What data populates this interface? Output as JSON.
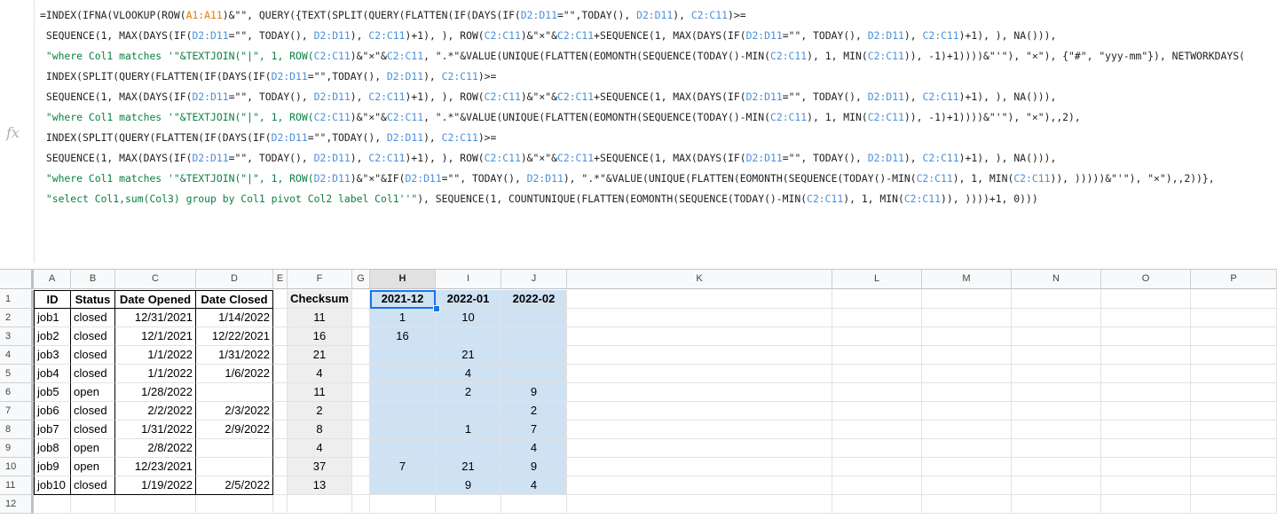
{
  "formula_bar": {
    "icon": "fx",
    "lines": [
      [
        [
          "=INDEX(IFNA(VLOOKUP(ROW(",
          ""
        ],
        [
          "A1:A11",
          "#e67c00"
        ],
        [
          ")&\"\", QUERY({TEXT(SPLIT(QUERY(FLATTEN(IF(DAYS(IF(",
          ""
        ],
        [
          "D2:D11",
          "#4a90d9"
        ],
        [
          "=\"\",TODAY(), ",
          ""
        ],
        [
          "D2:D11",
          "#4a90d9"
        ],
        [
          "), ",
          ""
        ],
        [
          "C2:C11",
          "#4a90d9"
        ],
        [
          ")>=",
          ""
        ]
      ],
      [
        [
          " SEQUENCE(1, MAX(DAYS(IF(",
          ""
        ],
        [
          "D2:D11",
          "#4a90d9"
        ],
        [
          "=\"\", TODAY(), ",
          ""
        ],
        [
          "D2:D11",
          "#4a90d9"
        ],
        [
          "), ",
          ""
        ],
        [
          "C2:C11",
          "#4a90d9"
        ],
        [
          ")+1), ), ROW(",
          ""
        ],
        [
          "C2:C11",
          "#4a90d9"
        ],
        [
          ")&\"×\"&",
          ""
        ],
        [
          "C2:C11",
          "#4a90d9"
        ],
        [
          "+SEQUENCE(1, MAX(DAYS(IF(",
          ""
        ],
        [
          "D2:D11",
          "#4a90d9"
        ],
        [
          "=\"\", TODAY(), ",
          ""
        ],
        [
          "D2:D11",
          "#4a90d9"
        ],
        [
          "), ",
          ""
        ],
        [
          "C2:C11",
          "#4a90d9"
        ],
        [
          ")+1), ), NA())),",
          ""
        ]
      ],
      [
        [
          " \"where Col1 matches '\"&TEXTJOIN(\"|\", 1, ROW(",
          "#0a8043"
        ],
        [
          "C2:C11",
          "#4a90d9"
        ],
        [
          ")&\"×\"&",
          ""
        ],
        [
          "C2:C11",
          "#4a90d9"
        ],
        [
          ", \".*\"&VALUE(UNIQUE(FLATTEN(EOMONTH(SEQUENCE(TODAY()-MIN(",
          ""
        ],
        [
          "C2:C11",
          "#4a90d9"
        ],
        [
          "), 1, MIN(",
          ""
        ],
        [
          "C2:C11",
          "#4a90d9"
        ],
        [
          ")), -1)+1))))&\"'\"), \"×\"), {\"#\", \"yyy-mm\"}), NETWORKDAYS(",
          ""
        ]
      ],
      [
        [
          " INDEX(SPLIT(QUERY(FLATTEN(IF(DAYS(IF(",
          ""
        ],
        [
          "D2:D11",
          "#4a90d9"
        ],
        [
          "=\"\",TODAY(), ",
          ""
        ],
        [
          "D2:D11",
          "#4a90d9"
        ],
        [
          "), ",
          ""
        ],
        [
          "C2:C11",
          "#4a90d9"
        ],
        [
          ")>=",
          ""
        ]
      ],
      [
        [
          " SEQUENCE(1, MAX(DAYS(IF(",
          ""
        ],
        [
          "D2:D11",
          "#4a90d9"
        ],
        [
          "=\"\", TODAY(), ",
          ""
        ],
        [
          "D2:D11",
          "#4a90d9"
        ],
        [
          "), ",
          ""
        ],
        [
          "C2:C11",
          "#4a90d9"
        ],
        [
          ")+1), ), ROW(",
          ""
        ],
        [
          "C2:C11",
          "#4a90d9"
        ],
        [
          ")&\"×\"&",
          ""
        ],
        [
          "C2:C11",
          "#4a90d9"
        ],
        [
          "+SEQUENCE(1, MAX(DAYS(IF(",
          ""
        ],
        [
          "D2:D11",
          "#4a90d9"
        ],
        [
          "=\"\", TODAY(), ",
          ""
        ],
        [
          "D2:D11",
          "#4a90d9"
        ],
        [
          "), ",
          ""
        ],
        [
          "C2:C11",
          "#4a90d9"
        ],
        [
          ")+1), ), NA())),",
          ""
        ]
      ],
      [
        [
          " \"where Col1 matches '\"&TEXTJOIN(\"|\", 1, ROW(",
          "#0a8043"
        ],
        [
          "C2:C11",
          "#4a90d9"
        ],
        [
          ")&\"×\"&",
          ""
        ],
        [
          "C2:C11",
          "#4a90d9"
        ],
        [
          ", \".*\"&VALUE(UNIQUE(FLATTEN(EOMONTH(SEQUENCE(TODAY()-MIN(",
          ""
        ],
        [
          "C2:C11",
          "#4a90d9"
        ],
        [
          "), 1, MIN(",
          ""
        ],
        [
          "C2:C11",
          "#4a90d9"
        ],
        [
          ")), -1)+1))))&\"'\"), \"×\"),,2),",
          ""
        ]
      ],
      [
        [
          " INDEX(SPLIT(QUERY(FLATTEN(IF(DAYS(IF(",
          ""
        ],
        [
          "D2:D11",
          "#4a90d9"
        ],
        [
          "=\"\",TODAY(), ",
          ""
        ],
        [
          "D2:D11",
          "#4a90d9"
        ],
        [
          "), ",
          ""
        ],
        [
          "C2:C11",
          "#4a90d9"
        ],
        [
          ")>=",
          ""
        ]
      ],
      [
        [
          " SEQUENCE(1, MAX(DAYS(IF(",
          ""
        ],
        [
          "D2:D11",
          "#4a90d9"
        ],
        [
          "=\"\", TODAY(), ",
          ""
        ],
        [
          "D2:D11",
          "#4a90d9"
        ],
        [
          "), ",
          ""
        ],
        [
          "C2:C11",
          "#4a90d9"
        ],
        [
          ")+1), ), ROW(",
          ""
        ],
        [
          "C2:C11",
          "#4a90d9"
        ],
        [
          ")&\"×\"&",
          ""
        ],
        [
          "C2:C11",
          "#4a90d9"
        ],
        [
          "+SEQUENCE(1, MAX(DAYS(IF(",
          ""
        ],
        [
          "D2:D11",
          "#4a90d9"
        ],
        [
          "=\"\", TODAY(), ",
          ""
        ],
        [
          "D2:D11",
          "#4a90d9"
        ],
        [
          "), ",
          ""
        ],
        [
          "C2:C11",
          "#4a90d9"
        ],
        [
          ")+1), ), NA())),",
          ""
        ]
      ],
      [
        [
          " \"where Col1 matches '\"&TEXTJOIN(\"|\", 1, ROW(",
          "#0a8043"
        ],
        [
          "D2:D11",
          "#4a90d9"
        ],
        [
          ")&\"×\"&IF(",
          ""
        ],
        [
          "D2:D11",
          "#4a90d9"
        ],
        [
          "=\"\", TODAY(), ",
          ""
        ],
        [
          "D2:D11",
          "#4a90d9"
        ],
        [
          "), \".*\"&VALUE(UNIQUE(FLATTEN(EOMONTH(SEQUENCE(TODAY()-MIN(",
          ""
        ],
        [
          "C2:C11",
          "#4a90d9"
        ],
        [
          "), 1, MIN(",
          ""
        ],
        [
          "C2:C11",
          "#4a90d9"
        ],
        [
          ")), )))))&\"'\"), \"×\"),,2))},",
          ""
        ]
      ],
      [
        [
          " \"select Col1,sum(Col3) group by Col1 pivot Col2 label Col1''\"",
          "#0a8043"
        ],
        [
          "), SEQUENCE(1, COUNTUNIQUE(FLATTEN(EOMONTH(SEQUENCE(TODAY()-MIN(",
          ""
        ],
        [
          "C2:C11",
          "#4a90d9"
        ],
        [
          "), 1, MIN(",
          ""
        ],
        [
          "C2:C11",
          "#4a90d9"
        ],
        [
          ")), ))))+1, 0)))",
          ""
        ]
      ]
    ]
  },
  "columns": [
    "A",
    "B",
    "C",
    "D",
    "E",
    "F",
    "G",
    "H",
    "I",
    "J",
    "K",
    "L",
    "M",
    "N",
    "O",
    "P"
  ],
  "selected_column": "H",
  "row_numbers": [
    "1",
    "2",
    "3",
    "4",
    "5",
    "6",
    "7",
    "8",
    "9",
    "10",
    "11",
    "12"
  ],
  "headers": {
    "A": "ID",
    "B": "Status",
    "C": "Date Opened",
    "D": "Date Closed",
    "F": "Checksum",
    "H": "2021-12",
    "I": "2022-01",
    "J": "2022-02"
  },
  "rows": [
    {
      "A": "job1",
      "B": "closed",
      "C": "12/31/2021",
      "D": "1/14/2022",
      "F": "11",
      "H": "1",
      "I": "10",
      "J": ""
    },
    {
      "A": "job2",
      "B": "closed",
      "C": "12/1/2021",
      "D": "12/22/2021",
      "F": "16",
      "H": "16",
      "I": "",
      "J": ""
    },
    {
      "A": "job3",
      "B": "closed",
      "C": "1/1/2022",
      "D": "1/31/2022",
      "F": "21",
      "H": "",
      "I": "21",
      "J": ""
    },
    {
      "A": "job4",
      "B": "closed",
      "C": "1/1/2022",
      "D": "1/6/2022",
      "F": "4",
      "H": "",
      "I": "4",
      "J": ""
    },
    {
      "A": "job5",
      "B": "open",
      "C": "1/28/2022",
      "D": "",
      "F": "11",
      "H": "",
      "I": "2",
      "J": "9"
    },
    {
      "A": "job6",
      "B": "closed",
      "C": "2/2/2022",
      "D": "2/3/2022",
      "F": "2",
      "H": "",
      "I": "",
      "J": "2"
    },
    {
      "A": "job7",
      "B": "closed",
      "C": "1/31/2022",
      "D": "2/9/2022",
      "F": "8",
      "H": "",
      "I": "1",
      "J": "7"
    },
    {
      "A": "job8",
      "B": "open",
      "C": "2/8/2022",
      "D": "",
      "F": "4",
      "H": "",
      "I": "",
      "J": "4"
    },
    {
      "A": "job9",
      "B": "open",
      "C": "12/23/2021",
      "D": "",
      "F": "37",
      "H": "7",
      "I": "21",
      "J": "9"
    },
    {
      "A": "job10",
      "B": "closed",
      "C": "1/19/2022",
      "D": "2/5/2022",
      "F": "13",
      "H": "",
      "I": "9",
      "J": "4"
    }
  ],
  "colors": {
    "highlight": "#cfe2f3",
    "checksum_bg": "#eeeeee",
    "selection": "#1a73e8"
  }
}
